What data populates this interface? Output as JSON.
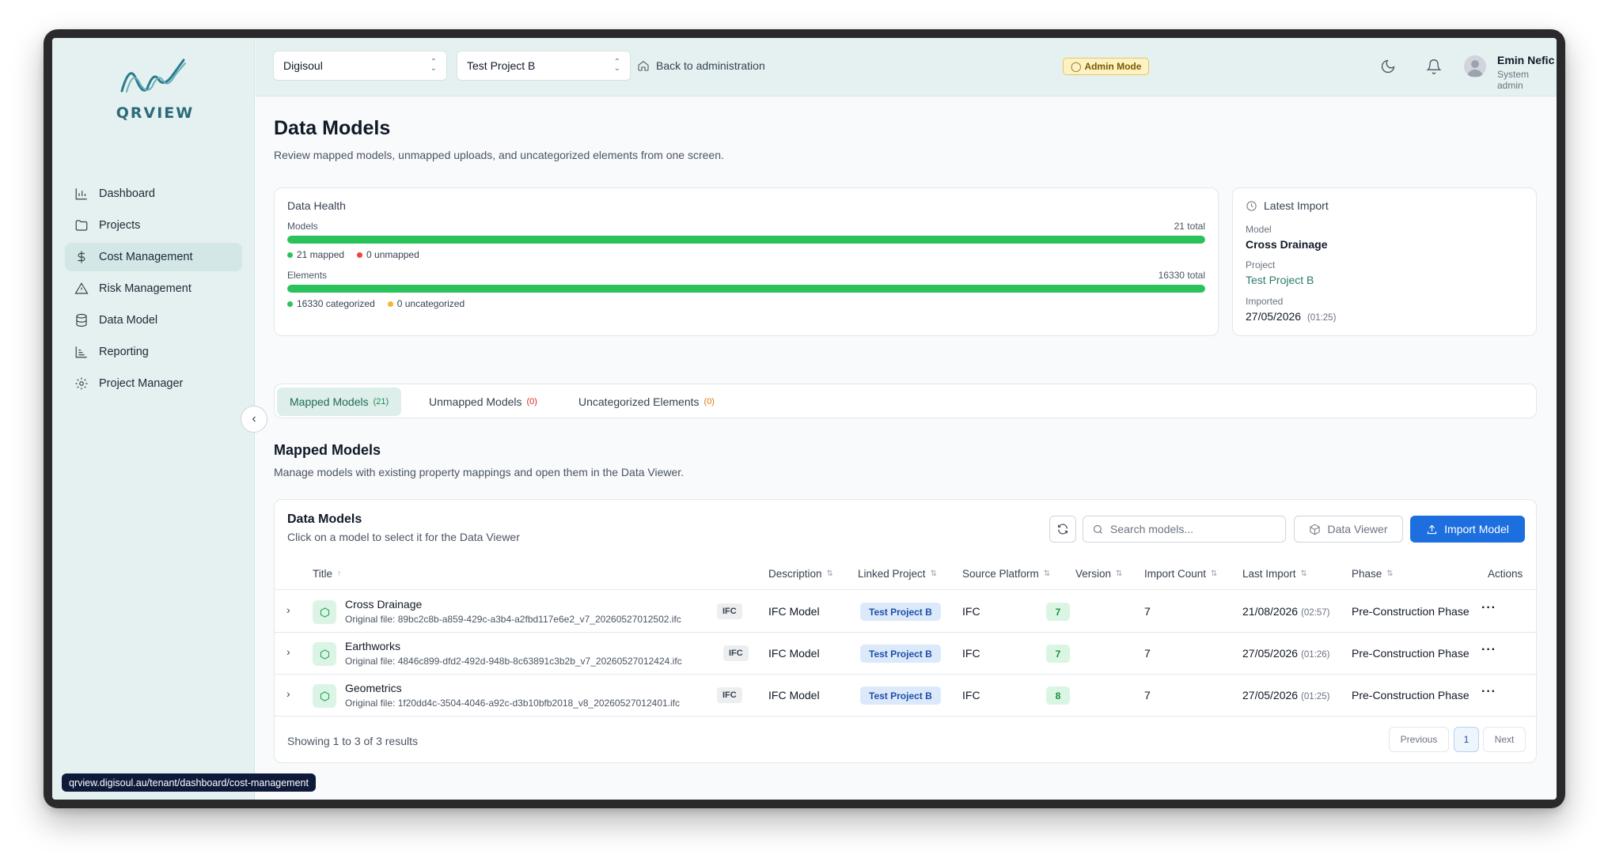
{
  "brand": {
    "logo_text": "QRVIEW"
  },
  "sidebar": {
    "items": [
      {
        "label": "Dashboard",
        "icon": "bar-chart-icon"
      },
      {
        "label": "Projects",
        "icon": "folder-icon"
      },
      {
        "label": "Cost Management",
        "icon": "dollar-icon",
        "active": true
      },
      {
        "label": "Risk Management",
        "icon": "warning-triangle-icon"
      },
      {
        "label": "Data Model",
        "icon": "database-icon"
      },
      {
        "label": "Reporting",
        "icon": "line-chart-icon"
      },
      {
        "label": "Project Manager",
        "icon": "gear-icon"
      }
    ]
  },
  "topbar": {
    "org_select": "Digisoul",
    "project_select": "Test Project B",
    "back_link": "Back to administration",
    "admin_badge": "Admin Mode",
    "user_name": "Emin Nefic",
    "user_role": "System admin"
  },
  "page": {
    "title": "Data Models",
    "subtitle": "Review mapped models, unmapped uploads, and uncategorized elements from one screen."
  },
  "health": {
    "title": "Data Health",
    "models_label": "Models",
    "models_total": "21 total",
    "models_mapped": "21 mapped",
    "models_unmapped": "0 unmapped",
    "models_mapped_fraction": 1.0,
    "elements_label": "Elements",
    "elements_total": "16330 total",
    "elements_categorized": "16330 categorized",
    "elements_uncategorized": "0 uncategorized",
    "elements_categorized_fraction": 1.0,
    "colors": {
      "good": "#2cc25b",
      "bad": "#ef4444",
      "warn": "#f5b52e"
    }
  },
  "latest_import": {
    "title": "Latest Import",
    "model_label": "Model",
    "model_value": "Cross Drainage",
    "project_label": "Project",
    "project_value": "Test Project B",
    "imported_label": "Imported",
    "imported_date": "27/05/2026",
    "imported_time": "(01:25)"
  },
  "tabs": [
    {
      "label": "Mapped Models",
      "count": "(21)",
      "active": true
    },
    {
      "label": "Unmapped Models",
      "count": "(0)"
    },
    {
      "label": "Uncategorized Elements",
      "count": "(0)"
    }
  ],
  "section": {
    "title": "Mapped Models",
    "subtitle": "Manage models with existing property mappings and open them in the Data Viewer."
  },
  "table": {
    "title": "Data Models",
    "subtitle": "Click on a model to select it for the Data Viewer",
    "search_placeholder": "Search models...",
    "data_viewer_label": "Data Viewer",
    "import_label": "Import Model",
    "columns": {
      "title": "Title",
      "description": "Description",
      "linked_project": "Linked Project",
      "source_platform": "Source Platform",
      "version": "Version",
      "import_count": "Import Count",
      "last_import": "Last Import",
      "phase": "Phase",
      "actions": "Actions"
    },
    "rows": [
      {
        "title": "Cross Drainage",
        "file": "Original file: 89bc2c8b-a859-429c-a3b4-a2fbd117e6e2_v7_20260527012502.ifc",
        "format": "IFC",
        "description": "IFC Model",
        "project": "Test Project B",
        "platform": "IFC",
        "version": "7",
        "import_count": "7",
        "last_import_date": "21/08/2026",
        "last_import_time": "(02:57)",
        "phase": "Pre-Construction Phase",
        "actions": "···"
      },
      {
        "title": "Earthworks",
        "file": "Original file: 4846c899-dfd2-492d-948b-8c63891c3b2b_v7_20260527012424.ifc",
        "format": "IFC",
        "description": "IFC Model",
        "project": "Test Project B",
        "platform": "IFC",
        "version": "7",
        "import_count": "7",
        "last_import_date": "27/05/2026",
        "last_import_time": "(01:26)",
        "phase": "Pre-Construction Phase",
        "actions": "···"
      },
      {
        "title": "Geometrics",
        "file": "Original file: 1f20dd4c-3504-4046-a92c-d3b10bfb2018_v8_20260527012401.ifc",
        "format": "IFC",
        "description": "IFC Model",
        "project": "Test Project B",
        "platform": "IFC",
        "version": "8",
        "import_count": "7",
        "last_import_date": "27/05/2026",
        "last_import_time": "(01:25)",
        "phase": "Pre-Construction Phase",
        "actions": "···"
      }
    ],
    "footer": "Showing 1 to 3 of 3 results",
    "pagination": {
      "previous": "Previous",
      "current": "1",
      "next": "Next"
    }
  },
  "status_url": "qrview.digisoul.au/tenant/dashboard/cost-management"
}
